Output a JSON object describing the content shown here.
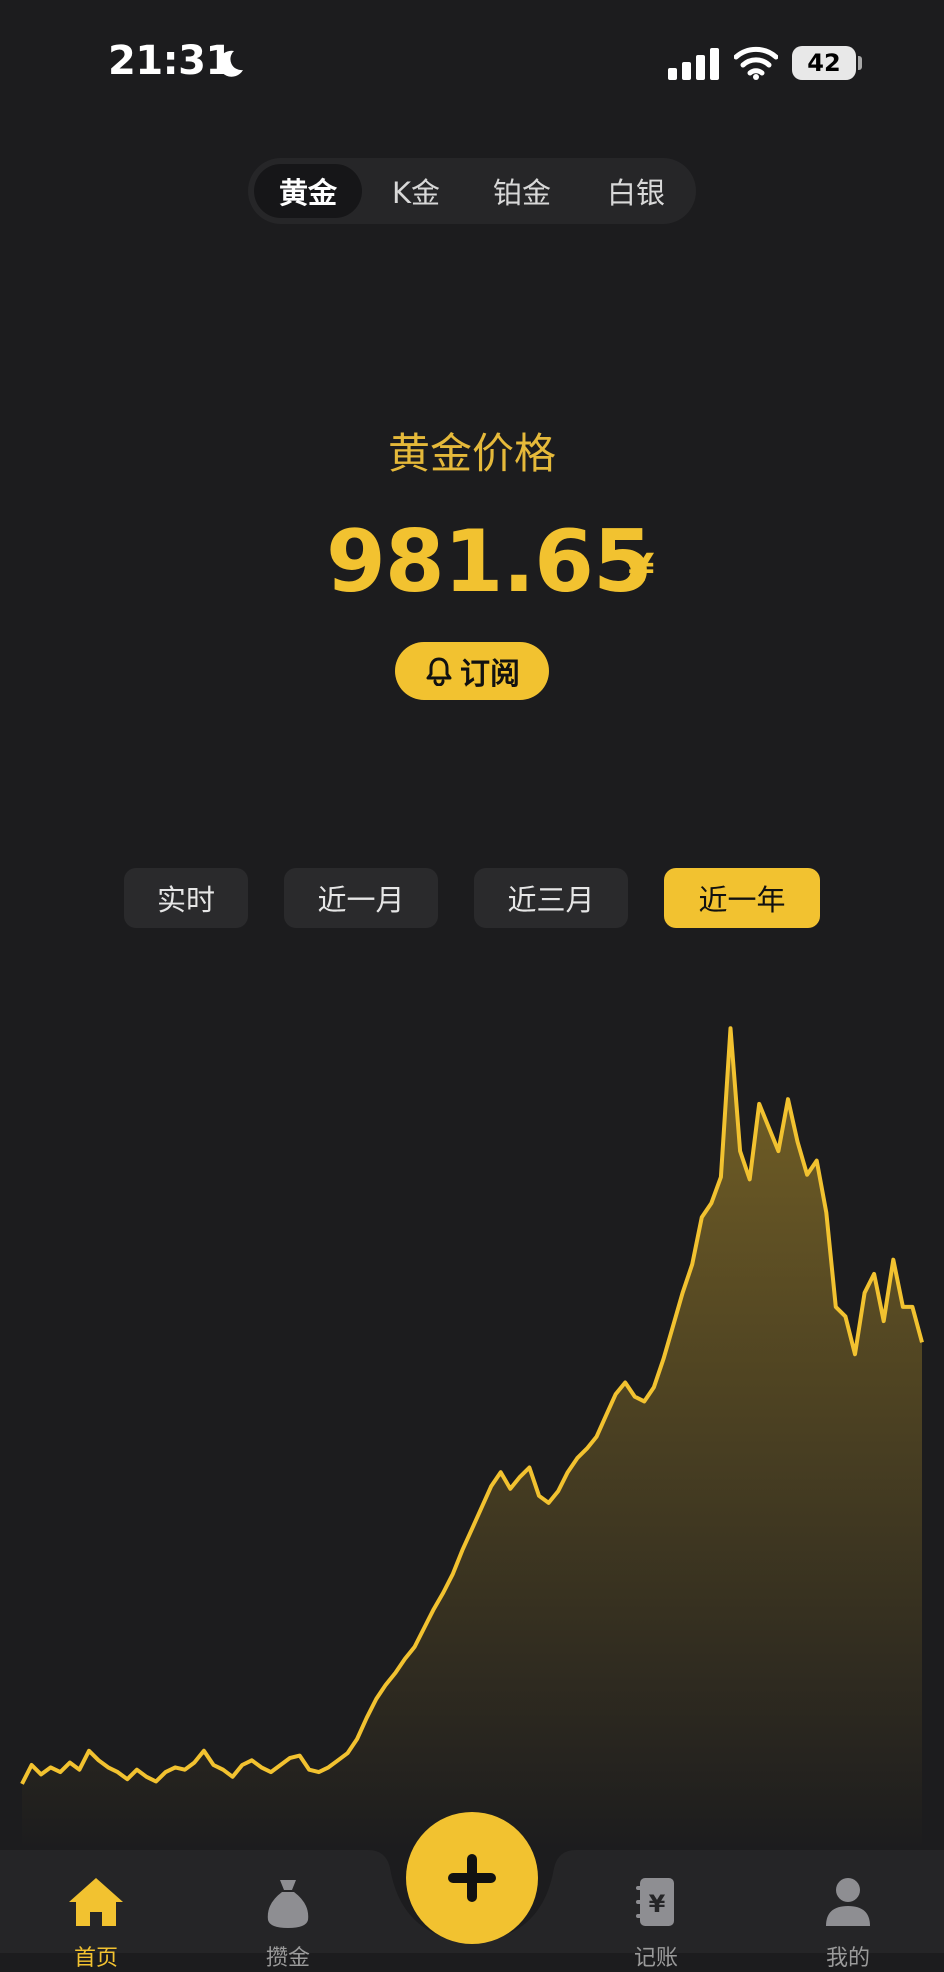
{
  "status_bar": {
    "time": "21:31",
    "battery": "42"
  },
  "metal_tabs": [
    {
      "label": "黄金",
      "active": true
    },
    {
      "label": "K金",
      "active": false
    },
    {
      "label": "铂金",
      "active": false
    },
    {
      "label": "白银",
      "active": false
    }
  ],
  "price": {
    "label": "黄金价格",
    "value": "981.65",
    "unit": "¥"
  },
  "subscribe": {
    "label": "订阅"
  },
  "range_tabs": [
    {
      "label": "实时",
      "active": false
    },
    {
      "label": "近一月",
      "active": false
    },
    {
      "label": "近三月",
      "active": false
    },
    {
      "label": "近一年",
      "active": true
    }
  ],
  "chart_data": {
    "type": "area",
    "title": "",
    "xlabel": "",
    "ylabel": "",
    "grid": false,
    "color": "#f2c230",
    "values": [
      28,
      36,
      32,
      35,
      33,
      37,
      34,
      42,
      38,
      35,
      33,
      30,
      34,
      31,
      29,
      33,
      35,
      34,
      37,
      42,
      36,
      34,
      31,
      36,
      38,
      35,
      33,
      36,
      39,
      40,
      34,
      33,
      35,
      38,
      41,
      47,
      56,
      64,
      70,
      75,
      81,
      86,
      94,
      102,
      109,
      117,
      127,
      136,
      145,
      154,
      160,
      153,
      158,
      162,
      150,
      147,
      152,
      160,
      166,
      170,
      175,
      184,
      193,
      198,
      192,
      190,
      196,
      208,
      222,
      236,
      248,
      268,
      274,
      285,
      348,
      296,
      284,
      316,
      306,
      296,
      318,
      300,
      286,
      292,
      270,
      230,
      226,
      210,
      236,
      244,
      224,
      250,
      230,
      230,
      215
    ],
    "ylim": [
      0,
      360
    ]
  },
  "tab_bar": {
    "items": [
      {
        "label": "首页",
        "icon": "home-icon",
        "active": true
      },
      {
        "label": "攒金",
        "icon": "money-bag-icon",
        "active": false
      },
      {
        "label": "记账",
        "icon": "ledger-icon",
        "active": false
      },
      {
        "label": "我的",
        "icon": "person-icon",
        "active": false
      }
    ],
    "add_icon": "plus-icon"
  }
}
